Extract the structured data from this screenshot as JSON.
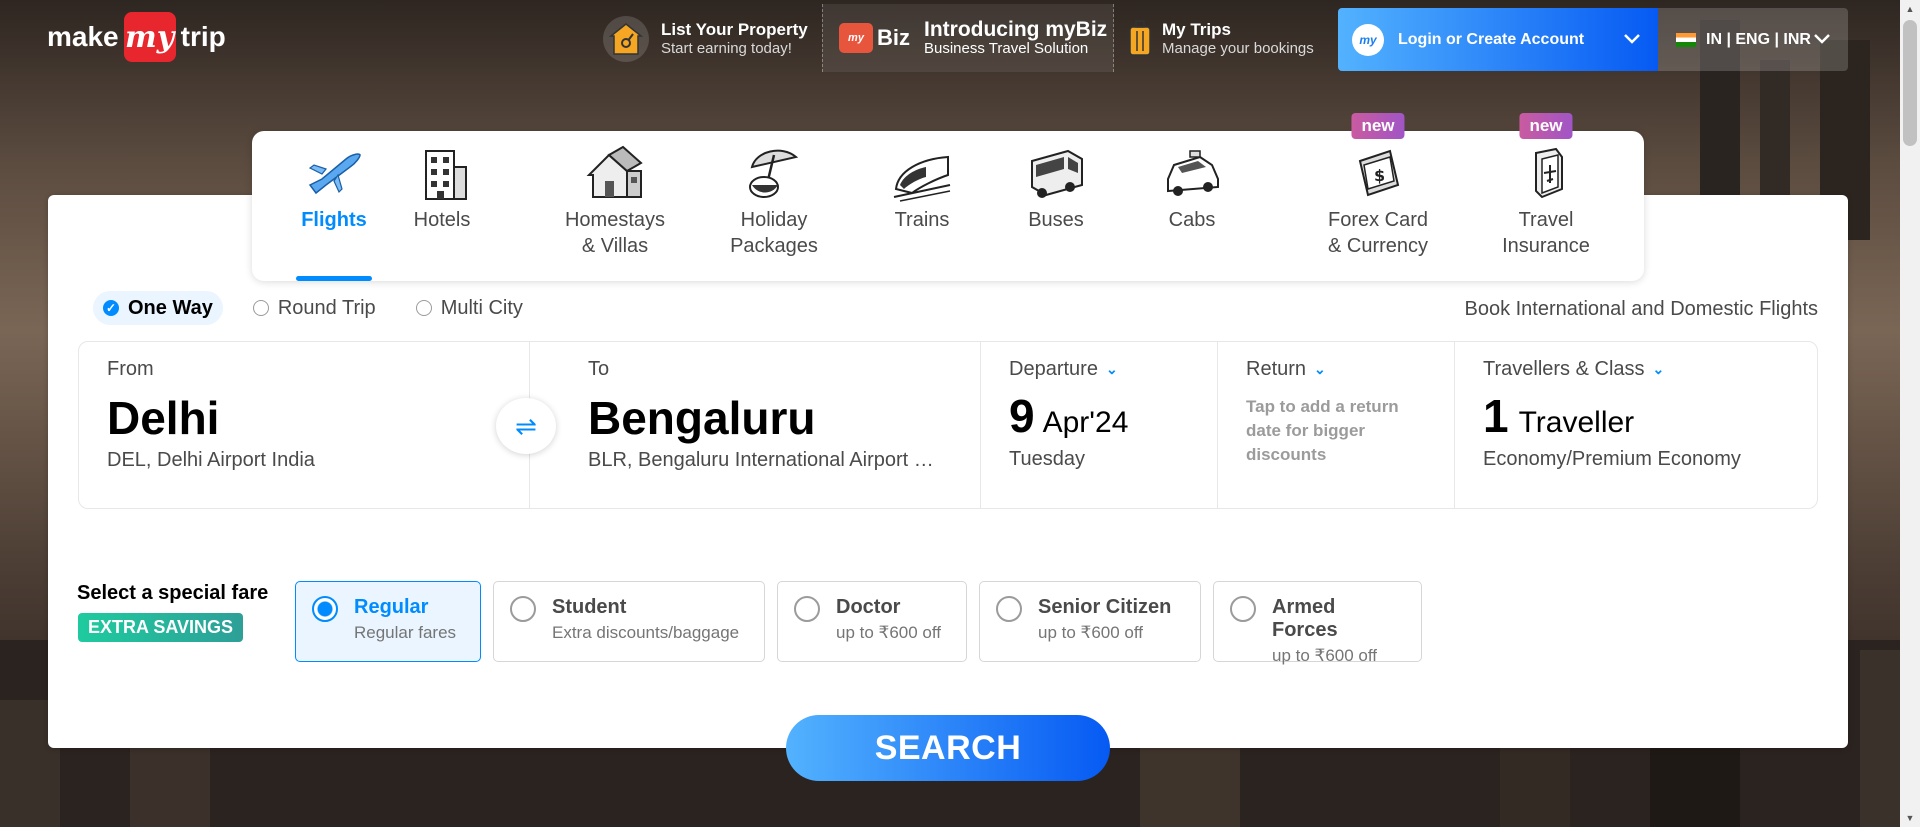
{
  "brand": {
    "make": "make",
    "my": "my",
    "trip": "trip"
  },
  "header": {
    "list_property": {
      "title": "List Your Property",
      "sub": "Start earning today!"
    },
    "mybiz": {
      "logo_word": "Biz",
      "logo_small": "my",
      "title": "Introducing myBiz",
      "sub": "Business Travel Solution"
    },
    "my_trips": {
      "title": "My Trips",
      "sub": "Manage your bookings"
    },
    "login": {
      "label": "Login or Create Account",
      "avatar": "my"
    },
    "locale": {
      "label": "IN | ENG | INR"
    }
  },
  "nav": [
    {
      "label": "Flights",
      "label2": "",
      "icon": "airplane-icon",
      "active": true
    },
    {
      "label": "Hotels",
      "label2": "",
      "icon": "hotel-icon"
    },
    {
      "label": "Homestays",
      "label2": "& Villas",
      "icon": "house-icon"
    },
    {
      "label": "Holiday",
      "label2": "Packages",
      "icon": "umbrella-icon"
    },
    {
      "label": "Trains",
      "label2": "",
      "icon": "train-icon"
    },
    {
      "label": "Buses",
      "label2": "",
      "icon": "bus-icon"
    },
    {
      "label": "Cabs",
      "label2": "",
      "icon": "car-icon"
    },
    {
      "label": "Forex Card",
      "label2": "& Currency",
      "icon": "forex-card-icon",
      "badge": "new"
    },
    {
      "label": "Travel",
      "label2": "Insurance",
      "icon": "insurance-icon",
      "badge": "new"
    }
  ],
  "trip_types": [
    {
      "label": "One Way",
      "selected": true
    },
    {
      "label": "Round Trip",
      "selected": false
    },
    {
      "label": "Multi City",
      "selected": false
    }
  ],
  "book_intl": "Book International and Domestic Flights",
  "search": {
    "from": {
      "label": "From",
      "city": "Delhi",
      "sub": "DEL, Delhi Airport India"
    },
    "to": {
      "label": "To",
      "city": "Bengaluru",
      "sub": "BLR, Bengaluru International Airport …"
    },
    "departure": {
      "label": "Departure",
      "day": "9",
      "month": "Apr'24",
      "weekday": "Tuesday"
    },
    "return": {
      "label": "Return",
      "hint": "Tap to add a return date for bigger discounts"
    },
    "travellers": {
      "label": "Travellers & Class",
      "count": "1",
      "word": "Traveller",
      "class": "Economy/Premium Economy"
    }
  },
  "special_fare": {
    "title": "Select a special fare",
    "badge": "EXTRA SAVINGS",
    "options": [
      {
        "name": "Regular",
        "desc": "Regular fares",
        "selected": true
      },
      {
        "name": "Student",
        "desc": "Extra discounts/baggage",
        "selected": false
      },
      {
        "name": "Doctor",
        "desc": "up to ₹600 off",
        "selected": false
      },
      {
        "name": "Senior Citizen",
        "desc": "up to ₹600 off",
        "selected": false
      },
      {
        "name": "Armed Forces",
        "desc": "up to ₹600 off",
        "selected": false
      }
    ]
  },
  "search_button": "SEARCH",
  "colors": {
    "accent": "#008cff",
    "brand_red": "#e8262d",
    "badge_green": "#1ecb9e",
    "new_badge": "#b157b8"
  }
}
